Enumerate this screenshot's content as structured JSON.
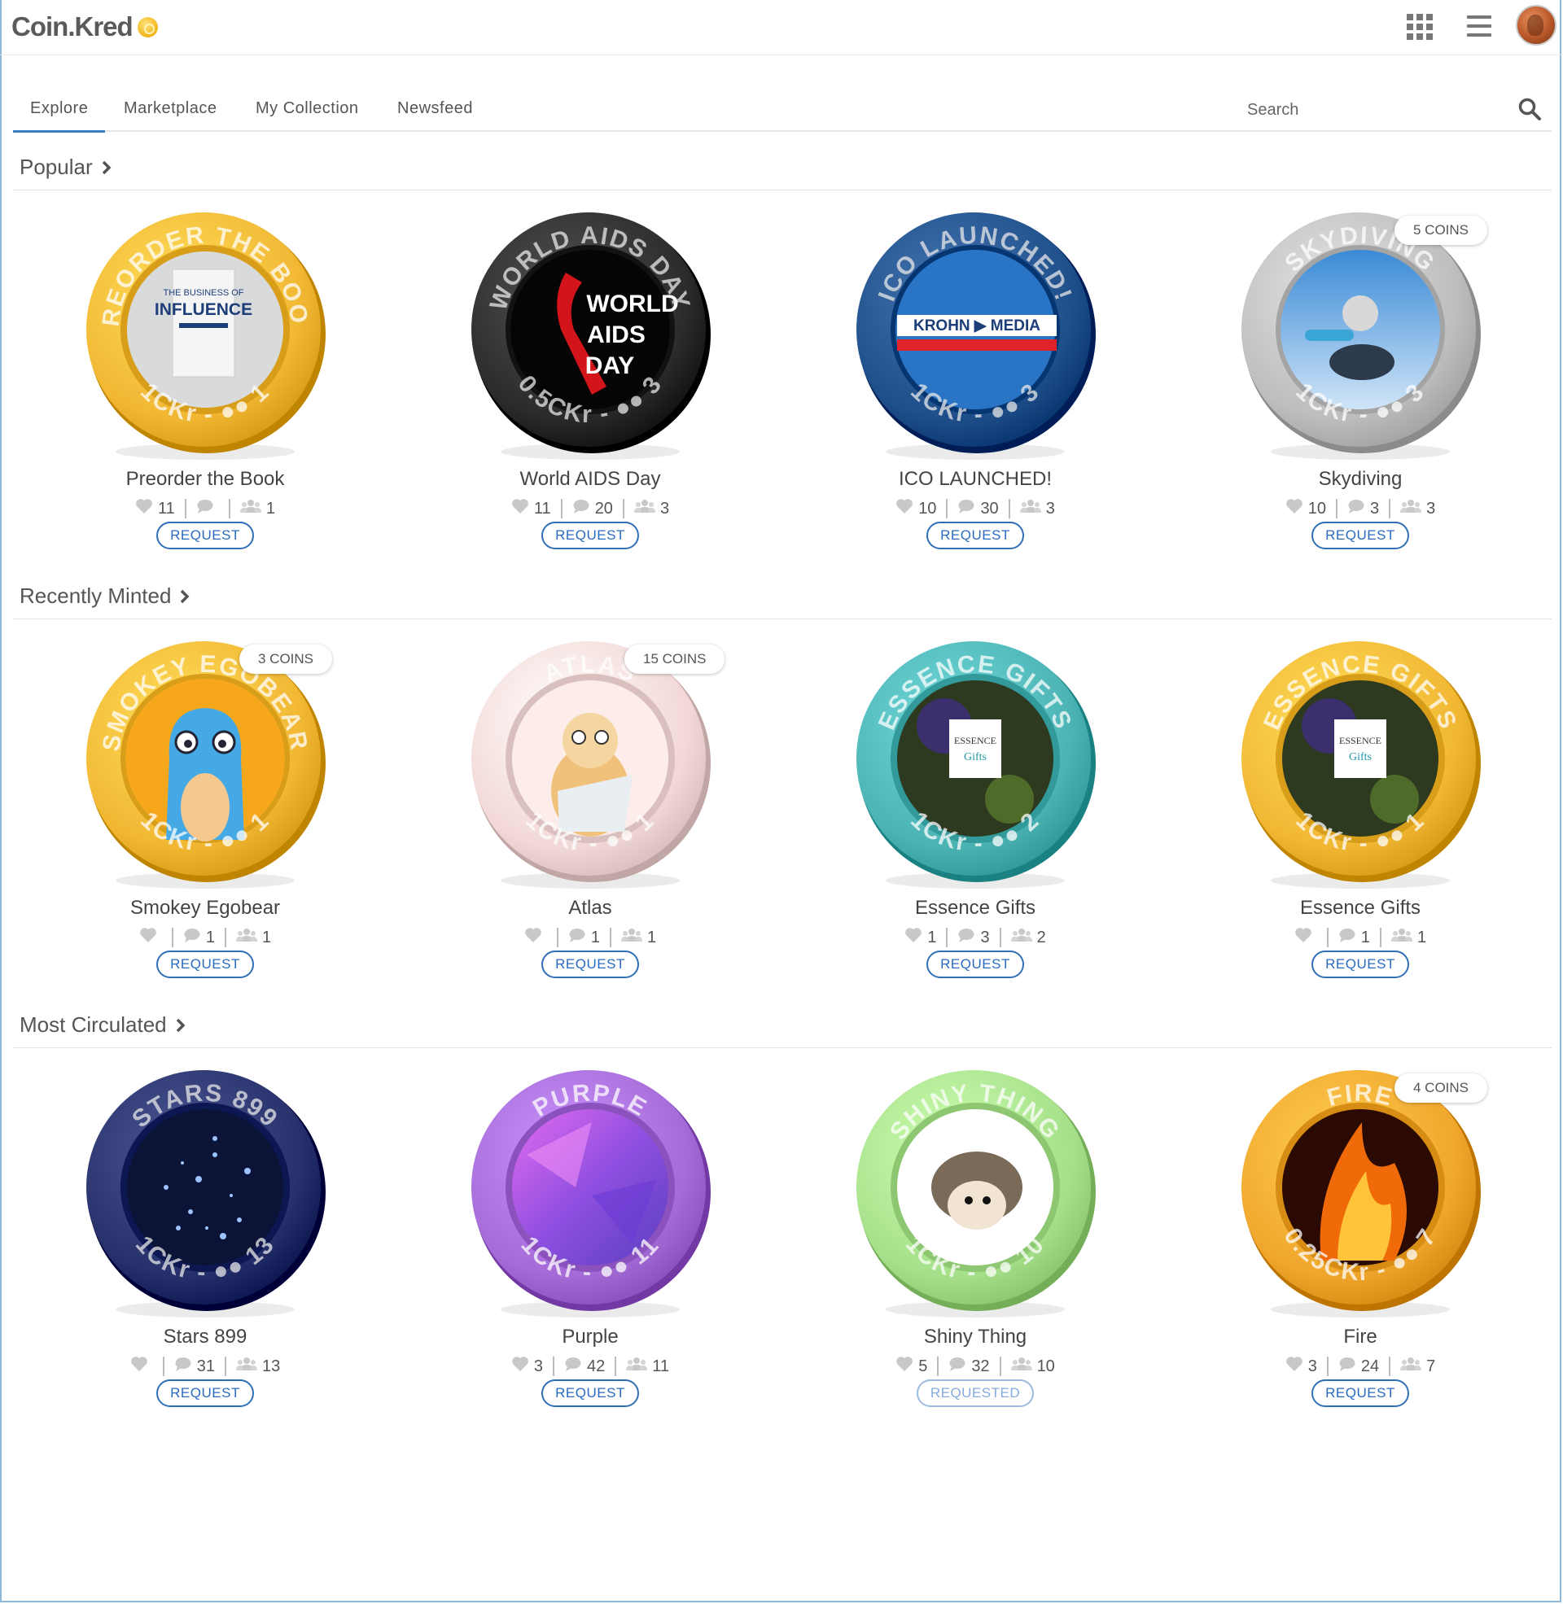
{
  "header": {
    "logo": "Coin.Kred",
    "icons": [
      "apps-grid-icon",
      "hamburger-menu-icon",
      "user-avatar"
    ]
  },
  "nav": {
    "tabs": [
      {
        "label": "Explore",
        "active": true
      },
      {
        "label": "Marketplace",
        "active": false
      },
      {
        "label": "My Collection",
        "active": false
      },
      {
        "label": "Newsfeed",
        "active": false
      }
    ],
    "search_placeholder": "Search"
  },
  "colors": {
    "accent": "#3a7cc5",
    "button": "#2a6bc2"
  },
  "sections": [
    {
      "title": "Popular",
      "cards": [
        {
          "name": "Preorder the Book",
          "ring_text": "PREORDER THE BOOK",
          "denomination": "1CKr",
          "holders": "1",
          "likes": "11",
          "comments": "",
          "people": "1",
          "button": "REQUEST",
          "badge": "",
          "ring_color": "#f1b733",
          "face": "book"
        },
        {
          "name": "World AIDS Day",
          "ring_text": "WORLD AIDS DAY",
          "denomination": "0.5CKr",
          "holders": "3",
          "likes": "11",
          "comments": "20",
          "people": "3",
          "button": "REQUEST",
          "badge": "",
          "ring_color": "#2b2b2b",
          "face": "aids"
        },
        {
          "name": "ICO LAUNCHED!",
          "ring_text": "ICO LAUNCHED!",
          "denomination": "1CKr",
          "holders": "3",
          "likes": "10",
          "comments": "30",
          "people": "3",
          "button": "REQUEST",
          "badge": "",
          "ring_color": "#1f4f8a",
          "face": "media"
        },
        {
          "name": "Skydiving",
          "ring_text": "SKYDIVING",
          "denomination": "1CKr",
          "holders": "3",
          "likes": "10",
          "comments": "3",
          "people": "3",
          "button": "REQUEST",
          "badge": "5 COINS",
          "ring_color": "#bdbdbd",
          "face": "sky"
        }
      ]
    },
    {
      "title": "Recently Minted",
      "cards": [
        {
          "name": "Smokey Egobear",
          "ring_text": "SMOKEY EGOBEAR",
          "denomination": "1CKr",
          "holders": "1",
          "likes": "",
          "comments": "1",
          "people": "1",
          "button": "REQUEST",
          "badge": "3 COINS",
          "ring_color": "#f1b733",
          "face": "cat-blue"
        },
        {
          "name": "Atlas",
          "ring_text": "ATLAS",
          "denomination": "1CKr",
          "holders": "1",
          "likes": "",
          "comments": "1",
          "people": "1",
          "button": "REQUEST",
          "badge": "15 COINS",
          "ring_color": "#f2d8d6",
          "face": "cat-cream"
        },
        {
          "name": "Essence Gifts",
          "ring_text": "ESSENCE GIFTS",
          "denomination": "1CKr",
          "holders": "2",
          "likes": "1",
          "comments": "3",
          "people": "2",
          "button": "REQUEST",
          "badge": "",
          "ring_color": "#4bb3b3",
          "face": "essence"
        },
        {
          "name": "Essence Gifts",
          "ring_text": "ESSENCE GIFTS",
          "denomination": "1CKr",
          "holders": "1",
          "likes": "",
          "comments": "1",
          "people": "1",
          "button": "REQUEST",
          "badge": "",
          "ring_color": "#f1b733",
          "face": "essence"
        }
      ]
    },
    {
      "title": "Most Circulated",
      "cards": [
        {
          "name": "Stars 899",
          "ring_text": "STARS 899",
          "denomination": "1CKr",
          "holders": "13",
          "likes": "",
          "comments": "31",
          "people": "13",
          "button": "REQUEST",
          "badge": "",
          "ring_color": "#26306a",
          "face": "stars"
        },
        {
          "name": "Purple",
          "ring_text": "PURPLE",
          "denomination": "1CKr",
          "holders": "11",
          "likes": "3",
          "comments": "42",
          "people": "11",
          "button": "REQUEST",
          "badge": "",
          "ring_color": "#a46bd6",
          "face": "purple"
        },
        {
          "name": "Shiny Thing",
          "ring_text": "SHINY THING",
          "denomination": "1CKr",
          "holders": "10",
          "likes": "5",
          "comments": "32",
          "people": "10",
          "button": "REQUESTED",
          "badge": "",
          "ring_color": "#a6e08a",
          "face": "hedgehog"
        },
        {
          "name": "Fire",
          "ring_text": "FIRE",
          "denomination": "0.25CKr",
          "holders": "7",
          "likes": "3",
          "comments": "24",
          "people": "7",
          "button": "REQUEST",
          "badge": "4 COINS",
          "ring_color": "#f0a62c",
          "face": "fire"
        }
      ]
    }
  ]
}
